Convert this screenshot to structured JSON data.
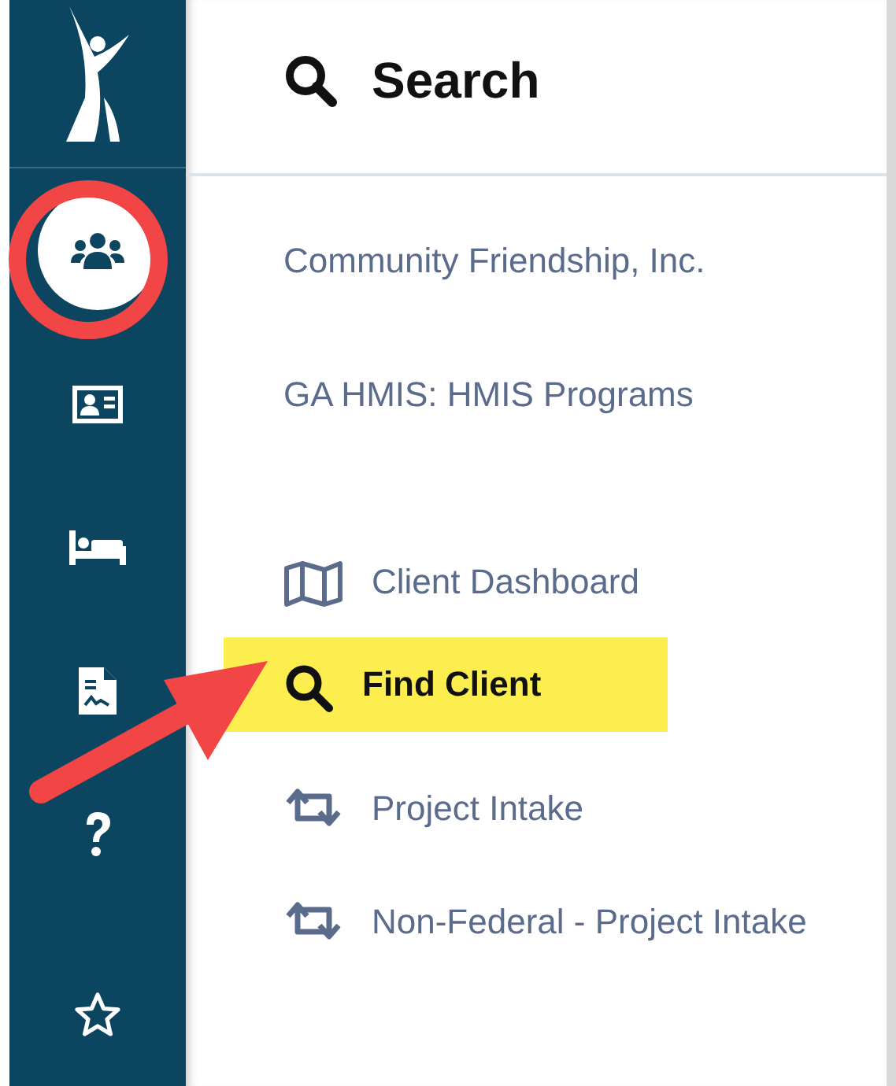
{
  "rail": {
    "items": [
      {
        "kind": "people",
        "selected": true
      },
      {
        "kind": "id-card",
        "selected": false
      },
      {
        "kind": "bed",
        "selected": false
      },
      {
        "kind": "document",
        "selected": false
      },
      {
        "kind": "help",
        "selected": false
      },
      {
        "kind": "star",
        "selected": false
      }
    ]
  },
  "panel": {
    "title": "Search",
    "agencies": [
      "Community Friendship, Inc.",
      "GA HMIS: HMIS Programs"
    ],
    "items": [
      {
        "kind": "map",
        "label": "Client Dashboard",
        "selected": false
      },
      {
        "kind": "search",
        "label": "Find Client",
        "selected": true
      },
      {
        "kind": "exchange",
        "label": "Project Intake",
        "selected": false
      },
      {
        "kind": "exchange",
        "label": "Non-Federal - Project Intake",
        "selected": false
      }
    ]
  },
  "annotations": [
    {
      "kind": "circle"
    },
    {
      "kind": "arrow"
    }
  ]
}
